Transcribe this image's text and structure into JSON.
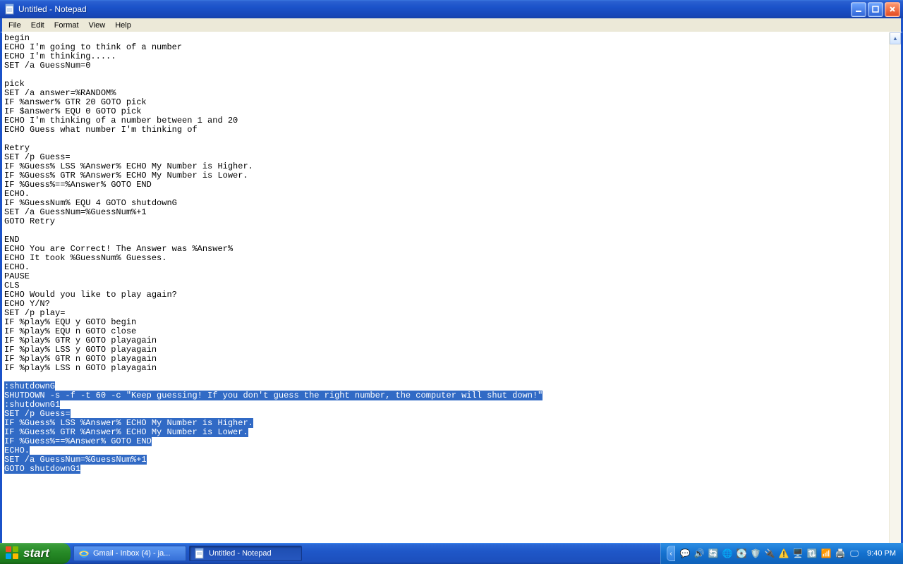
{
  "window": {
    "title": "Untitled - Notepad"
  },
  "menu": {
    "file": "File",
    "edit": "Edit",
    "format": "Format",
    "view": "View",
    "help": "Help"
  },
  "editor": {
    "plain_lines": [
      "begin",
      "ECHO I'm going to think of a number",
      "ECHO I'm thinking.....",
      "SET /a GuessNum=0",
      "",
      "pick",
      "SET /a answer=%RANDOM%",
      "IF %answer% GTR 20 GOTO pick",
      "IF $answer% EQU 0 GOTO pick",
      "ECHO I'm thinking of a number between 1 and 20",
      "ECHO Guess what number I'm thinking of",
      "",
      "Retry",
      "SET /p Guess=",
      "IF %Guess% LSS %Answer% ECHO My Number is Higher.",
      "IF %Guess% GTR %Answer% ECHO My Number is Lower.",
      "IF %Guess%==%Answer% GOTO END",
      "ECHO.",
      "IF %GuessNum% EQU 4 GOTO shutdownG",
      "SET /a GuessNum=%GuessNum%+1",
      "GOTO Retry",
      "",
      "END",
      "ECHO You are Correct! The Answer was %Answer%",
      "ECHO It took %GuessNum% Guesses.",
      "ECHO.",
      "PAUSE",
      "CLS",
      "ECHO Would you like to play again?",
      "ECHO Y/N?",
      "SET /p play=",
      "IF %play% EQU y GOTO begin",
      "IF %play% EQU n GOTO close",
      "IF %play% GTR y GOTO playagain",
      "IF %play% LSS y GOTO playagain",
      "IF %play% GTR n GOTO playagain",
      "IF %play% LSS n GOTO playagain",
      ""
    ],
    "selected_lines": [
      ":shutdownG",
      "SHUTDOWN -s -f -t 60 -c \"Keep guessing! If you don't guess the right number, the computer will shut down!\"",
      ":shutdownG1",
      "SET /p Guess=",
      "IF %Guess% LSS %Answer% ECHO My Number is Higher.",
      "IF %Guess% GTR %Answer% ECHO My Number is Lower.",
      "IF %Guess%==%Answer% GOTO END",
      "ECHO.",
      "SET /a GuessNum=%GuessNum%+1",
      "GOTO shutdownG1"
    ]
  },
  "taskbar": {
    "start": "start",
    "task1": "Gmail - Inbox (4) - ja...",
    "task2": "Untitled - Notepad",
    "clock": "9:40 PM"
  }
}
